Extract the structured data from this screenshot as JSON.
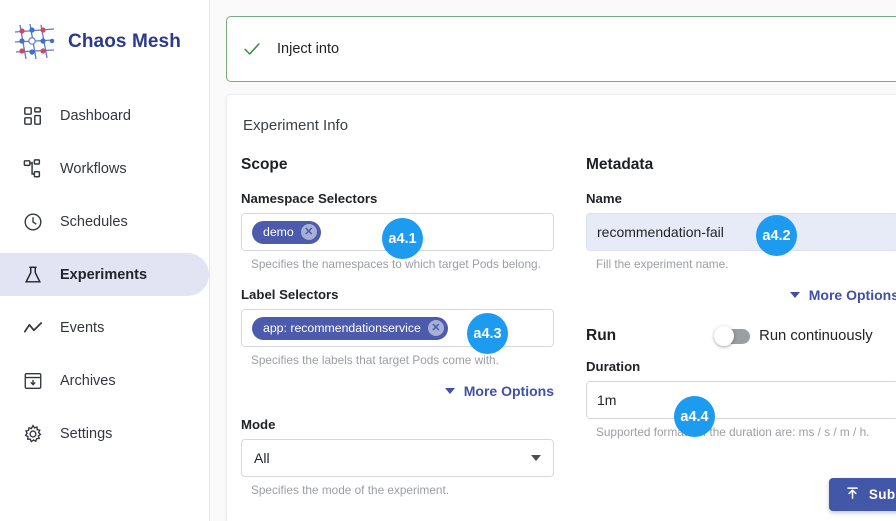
{
  "sidebar": {
    "brand": {
      "name": "Chaos Mesh",
      "logo_icon": "chaos-mesh-mesh-logo"
    },
    "items": [
      {
        "label": "Dashboard",
        "icon": "dashboard-grid-icon",
        "active": false
      },
      {
        "label": "Workflows",
        "icon": "workflows-tree-icon",
        "active": false
      },
      {
        "label": "Schedules",
        "icon": "clock-icon",
        "active": false
      },
      {
        "label": "Experiments",
        "icon": "flask-icon",
        "active": true
      },
      {
        "label": "Events",
        "icon": "timeline-chart-icon",
        "active": false
      },
      {
        "label": "Archives",
        "icon": "archive-box-icon",
        "active": false
      },
      {
        "label": "Settings",
        "icon": "gear-icon",
        "active": false
      }
    ]
  },
  "alert": {
    "text": "Inject into",
    "check_icon": "check-icon",
    "undo_icon": "undo-arrow-icon",
    "border_color": "#7aab7e"
  },
  "card": {
    "title": "Experiment Info",
    "scope": {
      "heading": "Scope",
      "namespace_selectors": {
        "label": "Namespace Selectors",
        "chips": [
          {
            "text": "demo",
            "remove_icon": "close-circle-icon"
          }
        ],
        "helper": "Specifies the namespaces to which target Pods belong."
      },
      "label_selectors": {
        "label": "Label Selectors",
        "chips": [
          {
            "text": "app: recommendationservice",
            "remove_icon": "close-circle-icon"
          }
        ],
        "helper": "Specifies the labels that target Pods come with."
      },
      "more_options": {
        "label": "More Options",
        "icon": "caret-down-icon"
      },
      "mode": {
        "label": "Mode",
        "value": "All",
        "helper": "Specifies the mode of the experiment.",
        "caret_icon": "caret-down-icon"
      }
    },
    "metadata": {
      "heading": "Metadata",
      "name": {
        "label": "Name",
        "value": "recommendation-fail",
        "helper": "Fill the experiment name."
      },
      "more_options": {
        "label": "More Options",
        "icon": "caret-down-icon"
      }
    },
    "run": {
      "heading": "Run",
      "toggle_label": "Run continuously",
      "toggle_on": false,
      "duration": {
        "label": "Duration",
        "value": "1m",
        "helper": "Supported formats of the duration are: ms / s / m / h."
      }
    },
    "submit": {
      "label": "Submit",
      "icon": "upload-icon",
      "color": "#4257a8"
    }
  },
  "annotations": [
    {
      "id": "a4.1",
      "label": "a4.1"
    },
    {
      "id": "a4.2",
      "label": "a4.2"
    },
    {
      "id": "a4.3",
      "label": "a4.3"
    },
    {
      "id": "a4.4",
      "label": "a4.4"
    }
  ]
}
